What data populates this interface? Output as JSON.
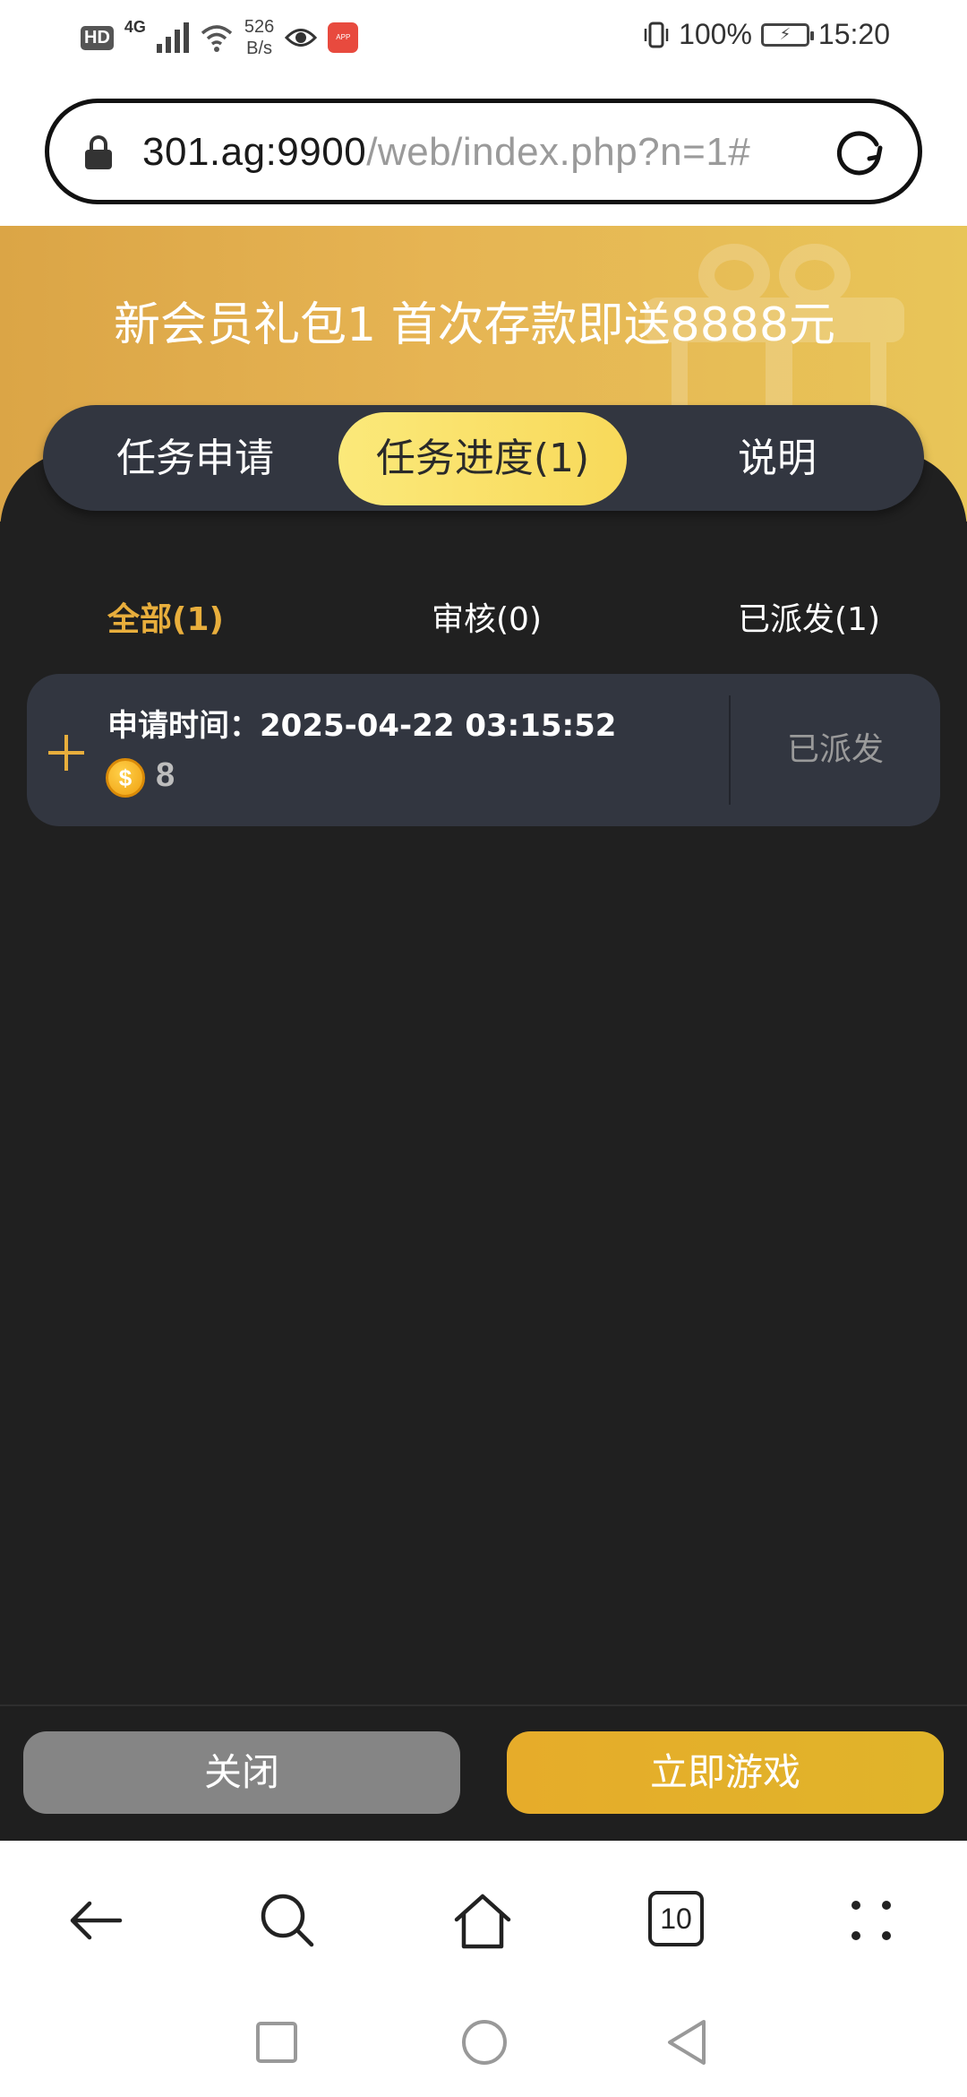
{
  "status_bar": {
    "hd": "HD",
    "network": "4G",
    "speed_value": "526",
    "speed_unit": "B/s",
    "battery": "100%",
    "time": "15:20"
  },
  "address_bar": {
    "url_host": "301.ag:9900",
    "url_path": "/web/index.php?n=1#"
  },
  "banner": {
    "title": "新会员礼包1 首次存款即送8888元"
  },
  "tabs": [
    {
      "label": "任务申请",
      "active": false
    },
    {
      "label": "任务进度(1)",
      "active": true
    },
    {
      "label": "说明",
      "active": false
    }
  ],
  "filters": [
    {
      "label": "全部(1)",
      "active": true
    },
    {
      "label": "审核(0)",
      "active": false
    },
    {
      "label": "已派发(1)",
      "active": false
    }
  ],
  "records": [
    {
      "time_label": "申请时间：",
      "time_value": "2025-04-22 03:15:52",
      "amount": "8",
      "status": "已派发"
    }
  ],
  "footer": {
    "close_label": "关闭",
    "play_label": "立即游戏"
  },
  "browser_nav": {
    "tab_count": "10"
  },
  "colors": {
    "accent_gold": "#e8ae3c",
    "active_tab": "#f8d95a",
    "dark_bg": "#202020",
    "card_bg": "#323640"
  }
}
